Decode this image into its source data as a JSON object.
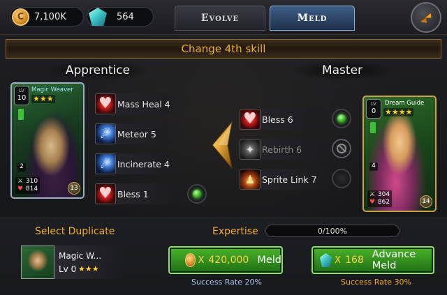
{
  "resources": {
    "gold": "7,100K",
    "gems": "564"
  },
  "tabs": {
    "evolve": "Evolve",
    "meld": "Meld",
    "active": "meld"
  },
  "title": "Change 4th skill",
  "apprentice": {
    "heading": "Apprentice",
    "card": {
      "level_label": "LV",
      "level": "10",
      "name": "Magic Weaver",
      "stars": "★★★",
      "slot": "2",
      "atk": "310",
      "hp": "814",
      "cost": "13"
    },
    "skills": [
      {
        "label": "Mass Heal 4",
        "icon": "heart-icon"
      },
      {
        "label": "Meteor 5",
        "icon": "meteor-icon"
      },
      {
        "label": "Incinerate 4",
        "icon": "meteor-icon"
      },
      {
        "label": "Bless 1",
        "icon": "heart-icon",
        "selected": true
      }
    ]
  },
  "master": {
    "heading": "Master",
    "card": {
      "level_label": "LV",
      "level": "0",
      "name": "Dream Guide",
      "stars": "★★★★",
      "slot": "4",
      "atk": "304",
      "hp": "862",
      "cost": "14"
    },
    "skills": [
      {
        "label": "Bless 6",
        "icon": "heart-icon",
        "state": "selected"
      },
      {
        "label": "Rebirth 6",
        "icon": "wing-icon",
        "state": "blocked"
      },
      {
        "label": "Sprite Link 7",
        "icon": "sprite-icon",
        "state": "empty"
      }
    ]
  },
  "bottom": {
    "select_duplicate": "Select Duplicate",
    "expertise_label": "Expertise",
    "expertise_value": "0/100%",
    "expertise_fraction": 0,
    "duplicate": {
      "name": "Magic W...",
      "level": "Lv 0",
      "stars": "★★★"
    },
    "meld_button": {
      "prefix": "X",
      "cost": "420,000",
      "label": "Meld"
    },
    "advance_button": {
      "prefix": "X",
      "cost": "168",
      "label": "Advance Meld"
    },
    "meld_rate": "Success Rate 20%",
    "advance_rate": "Success Rate 30%"
  },
  "colors": {
    "accent_gold": "#f0b020",
    "meld_rate": "#a9c4e8",
    "advance_rate": "#f0b020",
    "button_green": "#3a9a22"
  }
}
